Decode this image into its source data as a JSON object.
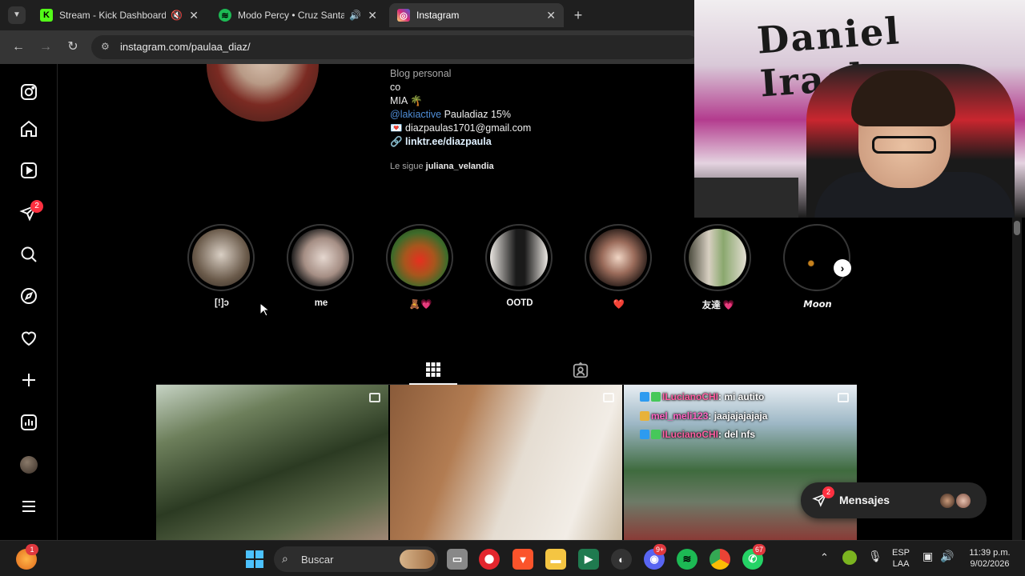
{
  "browser": {
    "tabs": [
      {
        "title": "Stream - Kick Dashboard",
        "icon": "kick-icon",
        "audio": "muted"
      },
      {
        "title": "Modo Percy • Cruz Santa",
        "icon": "spotify-icon",
        "audio": "playing"
      },
      {
        "title": "Instagram",
        "icon": "instagram-icon",
        "active": true
      }
    ],
    "new_tab": "+",
    "url": "instagram.com/paulaa_diaz/"
  },
  "sidenav": {
    "notification_count": "2"
  },
  "profile": {
    "bio_category": "Blog personal",
    "bio_lines": [
      "co",
      "MIA 🌴"
    ],
    "mention": "@lakiactive",
    "mention_text": " Pauladiaz 15%",
    "email": "💌 diazpaulas1701@gmail.com",
    "link": "linktr.ee/diazpaula",
    "followed_by_prefix": "Le sigue ",
    "followed_by_user": "juliana_velandia"
  },
  "highlights": [
    {
      "label": "[!]ↄ"
    },
    {
      "label": "me"
    },
    {
      "label": "🧸💗"
    },
    {
      "label": "OOTD"
    },
    {
      "label": "❤️"
    },
    {
      "label": "友達 💗"
    },
    {
      "label": "𝙈𝙤𝙤𝙣"
    }
  ],
  "chat_overlay": [
    {
      "user": "ILucianoCHI",
      "message": ": mi autito"
    },
    {
      "user": "mel_meli123",
      "message": ": jaajajajajaja"
    },
    {
      "user": "ILucianoCHI",
      "message": ": del nfs"
    }
  ],
  "messages": {
    "label": "Mensajes",
    "count": "2"
  },
  "webcam": {
    "graffiti_text": "Daniel Irache"
  },
  "taskbar": {
    "search_label": "Buscar",
    "discord_badge": "9+",
    "whatsapp_badge": "67",
    "app_badge": "1",
    "language": "ESP",
    "layout": "LAA",
    "time": "11:39 p.m.",
    "date": "9/02/2026"
  },
  "colors": {
    "instagram_bg": "#000000",
    "accent_link": "#4f8dd6",
    "notification_red": "#ff3040",
    "chrome_dark": "#1f1f1f"
  }
}
